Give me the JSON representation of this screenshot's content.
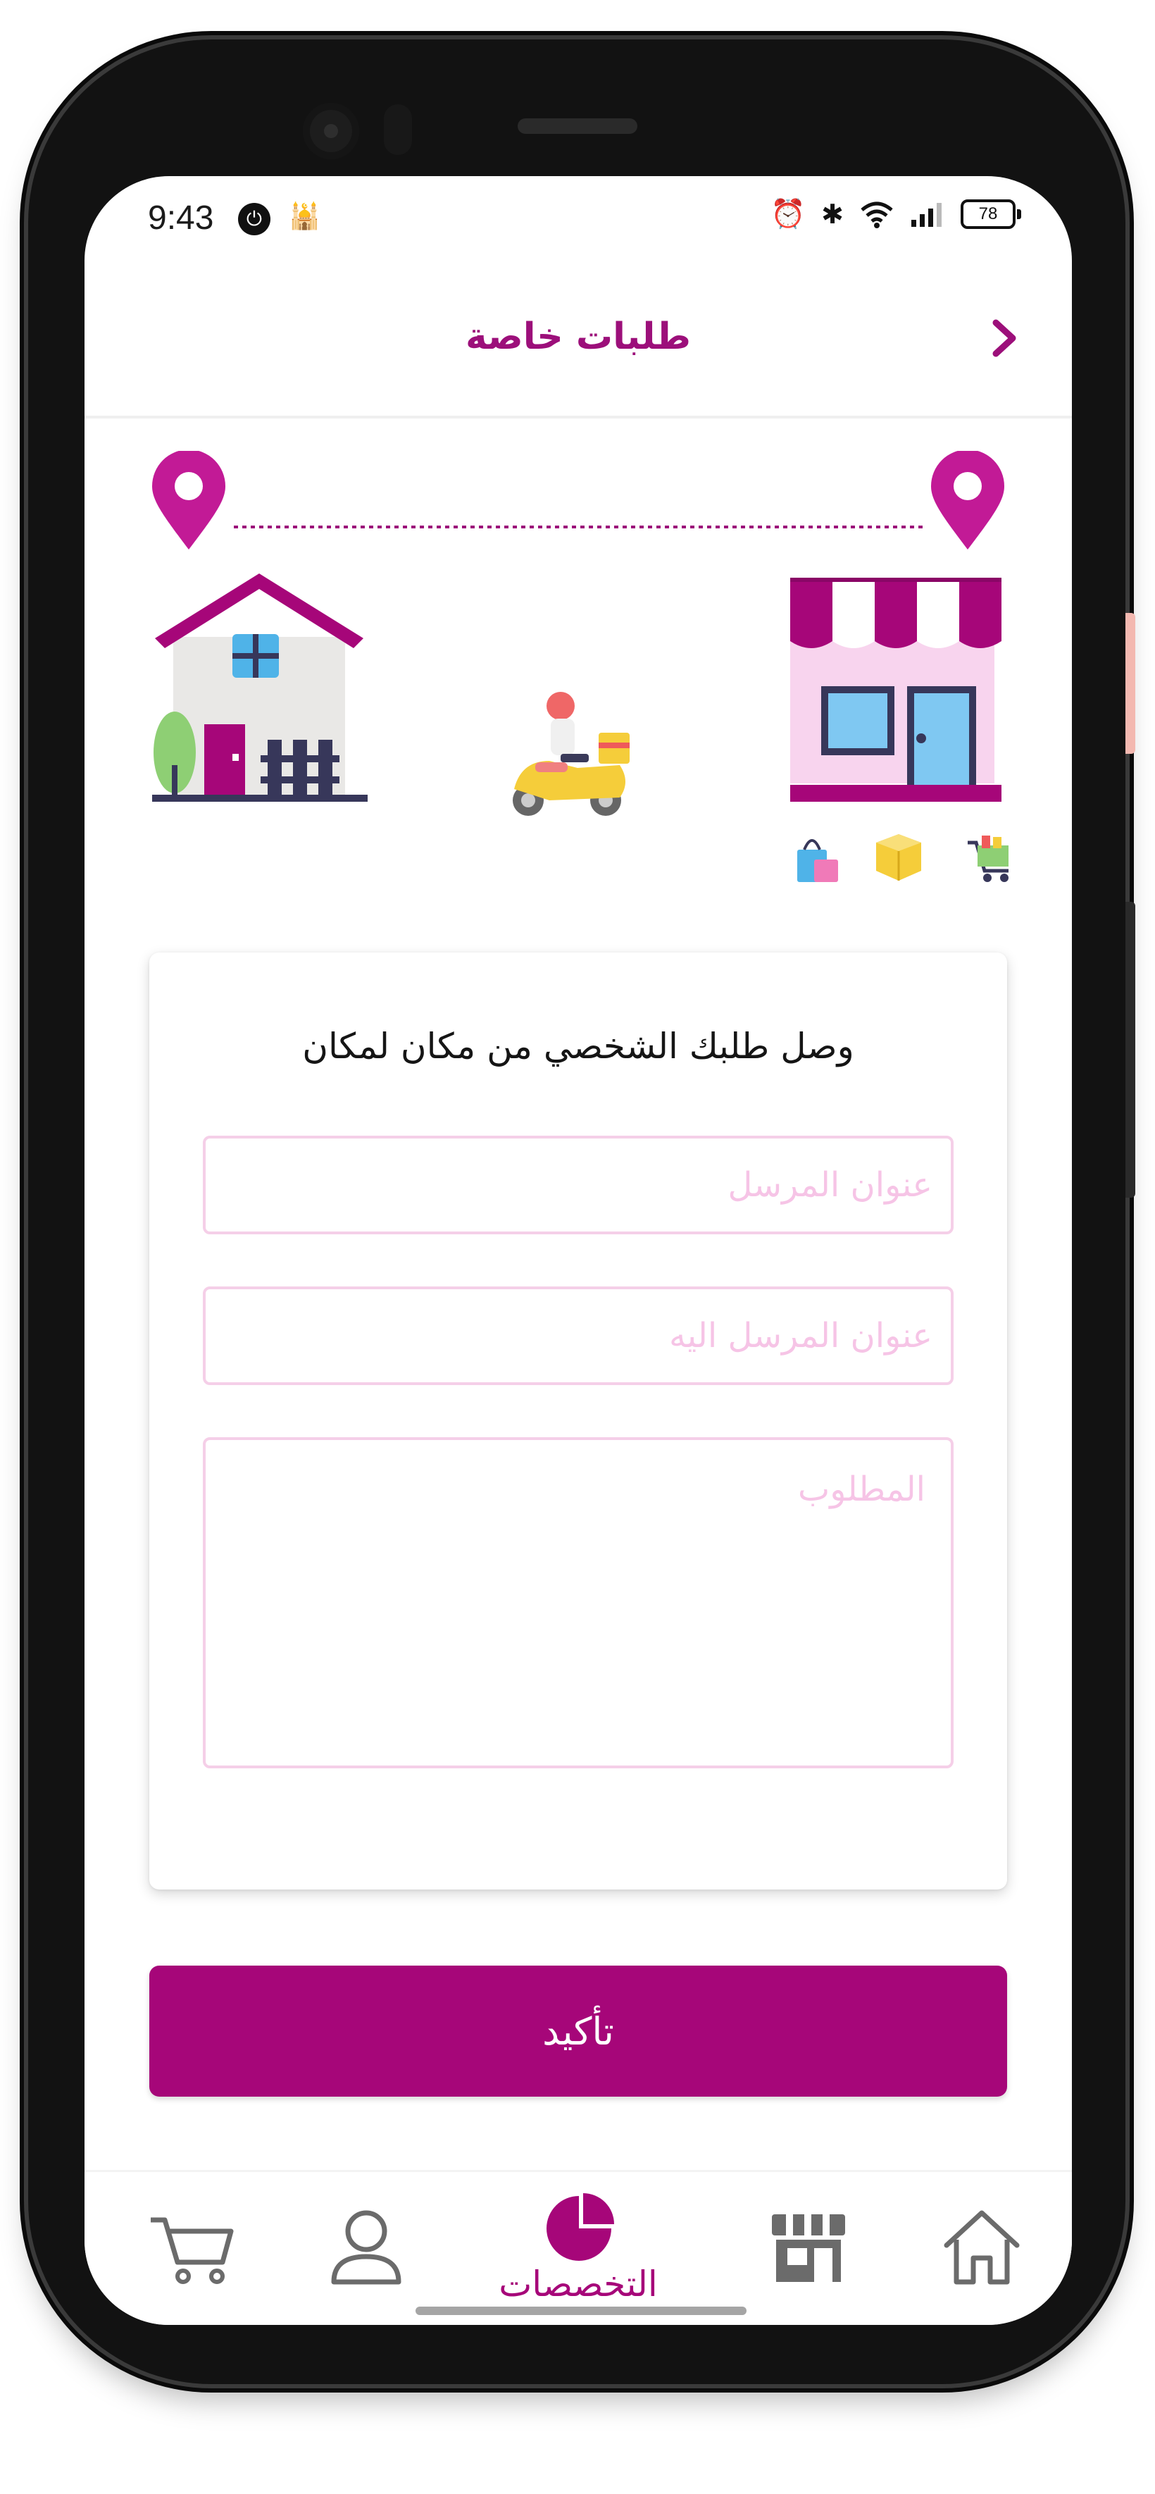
{
  "status_bar": {
    "time": "9:43",
    "battery": "78",
    "icons": [
      "power-icon",
      "mosque-icon",
      "alarm-icon",
      "bluetooth-icon",
      "wifi-icon",
      "signal-icon",
      "battery-icon"
    ]
  },
  "header": {
    "title": "طلبات خاصة",
    "back_icon": "chevron-right-icon"
  },
  "illustration": {
    "icons": [
      "location-pin-icon",
      "house-icon",
      "delivery-scooter-icon",
      "store-icon",
      "shopping-bag-icon",
      "package-box-icon",
      "shopping-cart-icon"
    ]
  },
  "form": {
    "heading": "وصل طلبك الشخصي من مكان لمكان",
    "sender_address_placeholder": "عنوان المرسل",
    "recipient_address_placeholder": "عنوان المرسل اليه",
    "request_placeholder": "المطلوب"
  },
  "confirm_button": {
    "label": "تأكيد"
  },
  "bottom_nav": {
    "active_label": "التخصصات",
    "items": [
      "cart-icon",
      "profile-icon",
      "specialties-icon",
      "store-icon",
      "home-icon"
    ]
  },
  "colors": {
    "accent": "#a60679",
    "title": "#9c0f7a",
    "placeholder": "#f6c4e6",
    "field_border": "#f5cfe8"
  }
}
